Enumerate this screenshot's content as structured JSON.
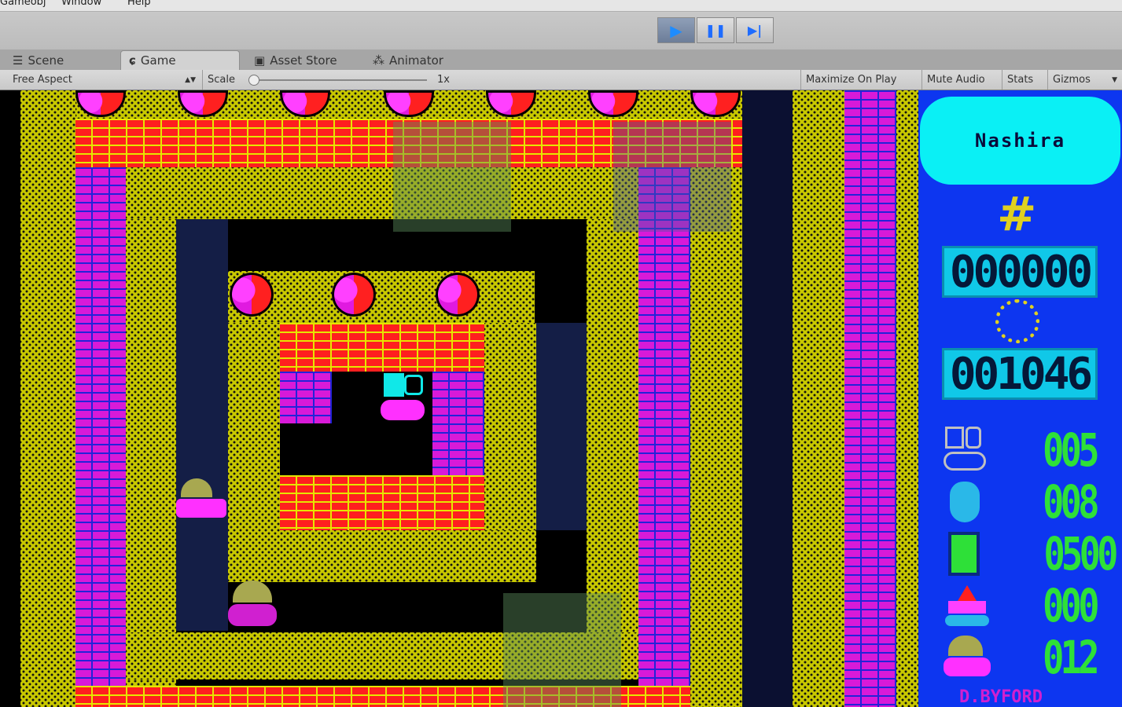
{
  "menu": {
    "items": [
      "Gameobj",
      "Window",
      "Help"
    ]
  },
  "playbar": {
    "play_label": "▶",
    "pause_label": "❚❚",
    "step_label": "▶|"
  },
  "tabs": [
    {
      "label": "Scene",
      "icon": "list-icon"
    },
    {
      "label": "Game",
      "icon": "pacman-icon"
    },
    {
      "label": "Asset Store",
      "icon": "store-icon"
    },
    {
      "label": "Animator",
      "icon": "animator-icon"
    }
  ],
  "gamebar": {
    "aspect": "Free Aspect",
    "scale_label": "Scale",
    "scale_value": "1x",
    "maximize": "Maximize On Play",
    "mute": "Mute Audio",
    "stats": "Stats",
    "gizmos": "Gizmos"
  },
  "hud": {
    "title": "Nashira",
    "score": "000000",
    "timer": "001046",
    "rows": [
      {
        "icon": "robot-icon",
        "value": "005"
      },
      {
        "icon": "grenade-icon",
        "value": "008"
      },
      {
        "icon": "battery-icon",
        "value": "0500"
      },
      {
        "icon": "rocket-icon",
        "value": "000"
      },
      {
        "icon": "tank-icon",
        "value": "012"
      }
    ],
    "author": "D.BYFORD"
  },
  "colors": {
    "yellow_wall": "#c8c800",
    "magenta_brick": "#d81ad8",
    "red_brick": "#ff1f1f",
    "hud_blue": "#0d36f0",
    "hud_cyan": "#0af0f5",
    "counter_green": "#2ee038"
  }
}
